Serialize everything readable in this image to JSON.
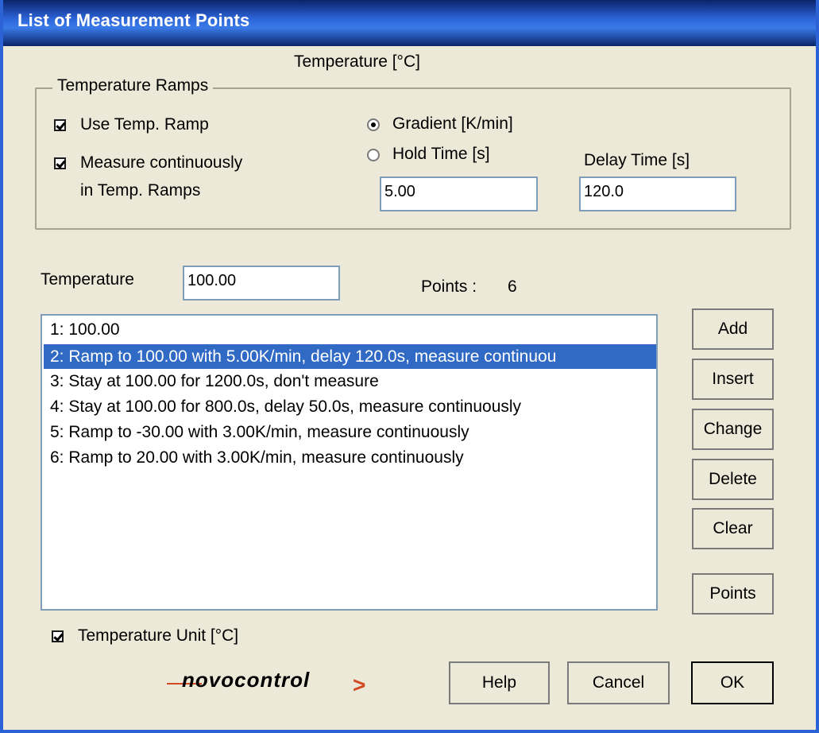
{
  "window": {
    "title": "List of Measurement Points",
    "header": "Temperature [°C]"
  },
  "ramps": {
    "legend": "Temperature Ramps",
    "use_ramp": {
      "label": "Use Temp. Ramp",
      "checked": true
    },
    "measure_cont": {
      "label_1": "Measure continuously",
      "label_2": "in Temp. Ramps",
      "checked": true
    },
    "gradient": {
      "label": "Gradient [K/min]",
      "selected": true
    },
    "hold_time": {
      "label": "Hold Time [s]",
      "selected": false
    },
    "gradient_value": "5.00",
    "delay_label": "Delay Time [s]",
    "delay_value": "120.0"
  },
  "temperature": {
    "label": "Temperature",
    "value": "100.00"
  },
  "points": {
    "label": "Points :",
    "count": "6"
  },
  "list": {
    "items": [
      "1: 100.00",
      "2: Ramp to 100.00 with 5.00K/min, delay 120.0s, measure continuou",
      "3: Stay at  100.00 for 1200.0s, don't measure",
      "4: Stay at  100.00 for 800.0s, delay 50.0s, measure continuously",
      "5: Ramp to -30.00 with 3.00K/min, measure continuously",
      "6: Ramp to  20.00 with 3.00K/min, measure continuously"
    ],
    "selected_index": 1
  },
  "buttons": {
    "add": "Add",
    "insert": "Insert",
    "change": "Change",
    "delete": "Delete",
    "clear": "Clear",
    "points": "Points",
    "help": "Help",
    "cancel": "Cancel",
    "ok": "OK"
  },
  "unit": {
    "label": "Temperature Unit [°C]",
    "checked": true
  },
  "logo": {
    "text": "novocontrol",
    "arrow": ">"
  },
  "colors": {
    "titlebar": "#0a246a",
    "selection": "#316ac5",
    "logo_accent": "#d24a22",
    "dialog_bg": "#ece9d8"
  }
}
